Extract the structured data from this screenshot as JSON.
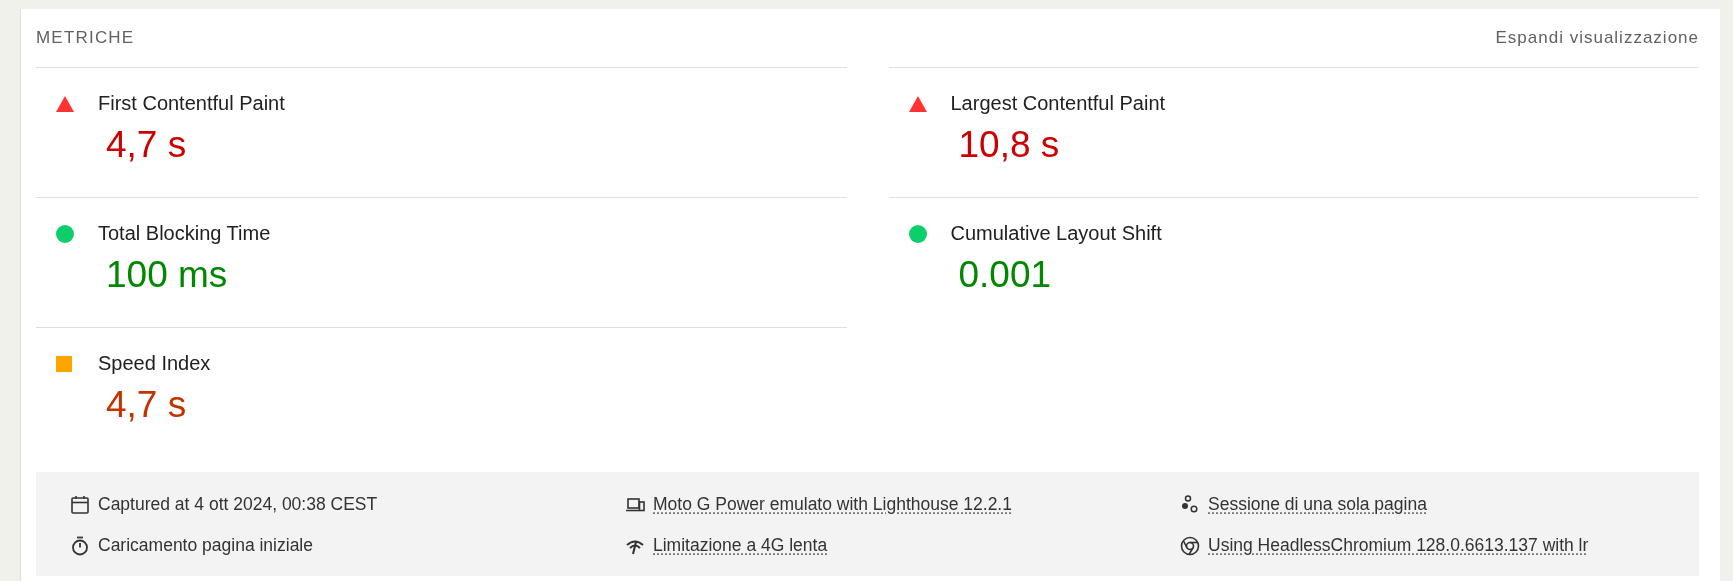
{
  "header": {
    "title": "METRICHE",
    "toggle": "Espandi visualizzazione"
  },
  "metrics": [
    {
      "title": "First Contentful Paint",
      "value": "4,7 s",
      "kind": "fail"
    },
    {
      "title": "Largest Contentful Paint",
      "value": "10,8 s",
      "kind": "fail"
    },
    {
      "title": "Total Blocking Time",
      "value": "100 ms",
      "kind": "pass"
    },
    {
      "title": "Cumulative Layout Shift",
      "value": "0.001",
      "kind": "pass"
    },
    {
      "title": "Speed Index",
      "value": "4,7 s",
      "kind": "average"
    }
  ],
  "footer": [
    {
      "kind": "calendar",
      "text": "Captured at 4 ott 2024, 00:38 CEST",
      "link": false
    },
    {
      "kind": "devices",
      "text": "Moto G Power emulato with Lighthouse 12.2.1",
      "link": true
    },
    {
      "kind": "dots",
      "text": "Sessione di una sola pagina",
      "link": true
    },
    {
      "kind": "stopwatch",
      "text": "Caricamento pagina iniziale",
      "link": false
    },
    {
      "kind": "network",
      "text": "Limitazione a 4G lenta",
      "link": true
    },
    {
      "kind": "browser",
      "text": "Using HeadlessChromium 128.0.6613.137 with lr",
      "link": true
    }
  ]
}
